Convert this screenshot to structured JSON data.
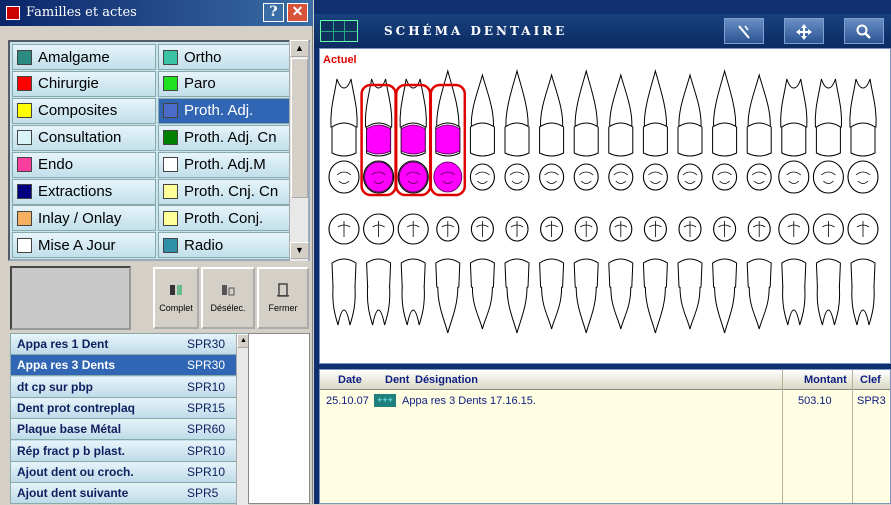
{
  "left_panel": {
    "title": "Familles et actes",
    "help_label": "?",
    "close_label": "✕"
  },
  "families": [
    {
      "label": "Amalgame",
      "color": "#2b8a82"
    },
    {
      "label": "Ortho",
      "color": "#3bc3a6"
    },
    {
      "label": "Chirurgie",
      "color": "#ff0000"
    },
    {
      "label": "Paro",
      "color": "#20e020"
    },
    {
      "label": "Composites",
      "color": "#ffff00"
    },
    {
      "label": "Proth. Adj.",
      "color": "#4a6cc8",
      "selected": true
    },
    {
      "label": "Consultation",
      "color": "#d8f4f8"
    },
    {
      "label": "Proth. Adj. Cn",
      "color": "#008000"
    },
    {
      "label": "Endo",
      "color": "#ff3fa0"
    },
    {
      "label": "Proth. Adj.M",
      "color": "#ffffff"
    },
    {
      "label": "Extractions",
      "color": "#000080"
    },
    {
      "label": "Proth. Cnj. Cn",
      "color": "#ffff99"
    },
    {
      "label": "Inlay / Onlay",
      "color": "#f4b060"
    },
    {
      "label": "Proth. Conj.",
      "color": "#ffff99"
    },
    {
      "label": "Mise A Jour",
      "color": "#ffffff"
    },
    {
      "label": "Radio",
      "color": "#2f8fa8"
    }
  ],
  "tools": {
    "complet": "Complet",
    "deselec": "Désélec.",
    "fermer": "Fermer"
  },
  "acts": [
    {
      "name": "Appa res 1 Dent",
      "code": "SPR30"
    },
    {
      "name": "Appa res 3  Dents",
      "code": "SPR30",
      "selected": true
    },
    {
      "name": "dt cp sur pbp",
      "code": "SPR10"
    },
    {
      "name": "Dent prot contreplaq",
      "code": "SPR15"
    },
    {
      "name": "Plaque base Métal",
      "code": "SPR60"
    },
    {
      "name": "Rép fract p b plast.",
      "code": "SPR10"
    },
    {
      "name": "Ajout dent ou croch.",
      "code": "SPR10"
    },
    {
      "name": "Ajout dent suivante",
      "code": "SPR5"
    }
  ],
  "schema": {
    "title": "SCHÉMA DENTAIRE",
    "actuel": "Actuel",
    "highlight_color": "#e00000",
    "treatment_color": "#ff00ff"
  },
  "table": {
    "headers": {
      "date": "Date",
      "dent": "Dent",
      "designation": "Désignation",
      "montant": "Montant",
      "clef": "Clef"
    },
    "rows": [
      {
        "date": "25.10.07",
        "dent": "+++",
        "designation": "Appa res 3  Dents 17.16.15.",
        "montant": "503.10",
        "clef": "SPR3"
      }
    ]
  }
}
